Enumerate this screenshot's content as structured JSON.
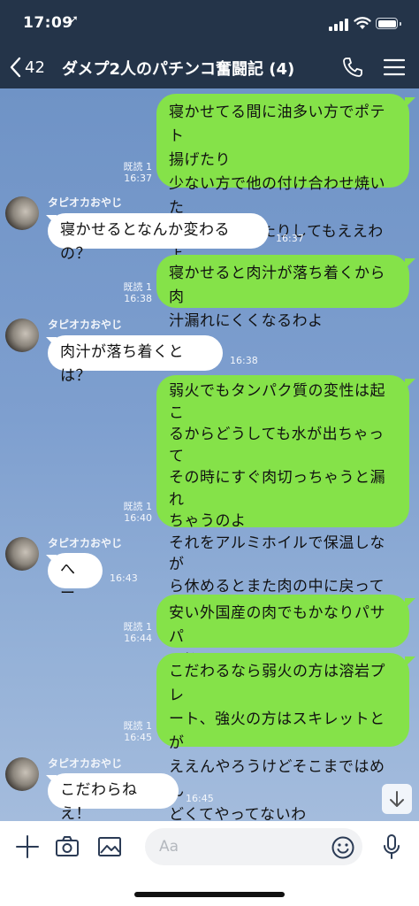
{
  "status_bar": {
    "time": "17:09",
    "location_glyph": "➚"
  },
  "header": {
    "back_count": "42",
    "title": "ダメプ2人のパチンコ奮闘記 (4)"
  },
  "messages": [
    {
      "dir": "out",
      "text": "寝かせてる間に油多い方でポテト\n揚げたり\n少ない方で他の付け合わせ焼いた\nりソース作ったりしてもええわよ",
      "read": "既読 1",
      "time": "16:37"
    },
    {
      "dir": "in",
      "sender": "タピオカおやじ",
      "text": "寝かせるとなんか変わるの？",
      "time": "16:37"
    },
    {
      "dir": "out",
      "text": "寝かせると肉汁が落ち着くから肉\n汁漏れにくくなるわよ",
      "read": "既読 1",
      "time": "16:38"
    },
    {
      "dir": "in",
      "sender": "タピオカおやじ",
      "text": "肉汁が落ち着くとは？",
      "time": "16:38"
    },
    {
      "dir": "out",
      "text": "弱火でもタンパク質の変性は起こ\nるからどうしても水が出ちゃって\nその時にすぐ肉切っちゃうと漏れ\nちゃうのよ\nそれをアルミホイルで保温しなが\nら休めるとまた肉の中に戻ってい\nくねん",
      "read": "既読 1",
      "time": "16:40"
    },
    {
      "dir": "in",
      "sender": "タピオカおやじ",
      "text": "へー",
      "time": "16:43"
    },
    {
      "dir": "out",
      "text": "安い外国産の肉でもかなりパサパ\nサ抑えられるで",
      "read": "既読 1",
      "time": "16:44"
    },
    {
      "dir": "out",
      "text": "こだわるなら弱火の方は溶岩プレ\nート、強火の方はスキレットとが\nええんやろうけどそこまではめん\nどくてやってないわ",
      "read": "既読 1",
      "time": "16:45"
    },
    {
      "dir": "in",
      "sender": "タピオカおやじ",
      "text": "こだわらねえ！",
      "time": "16:45"
    }
  ],
  "input": {
    "placeholder": "Aa"
  },
  "colors": {
    "header_bg": "#243449",
    "outgoing_bubble": "#85e249",
    "incoming_bubble": "#ffffff",
    "chat_bg": "#7e9fcf"
  },
  "icons": [
    "chevron-left-icon",
    "phone-icon",
    "menu-icon",
    "plus-icon",
    "camera-icon",
    "image-icon",
    "emoji-icon",
    "microphone-icon",
    "arrow-down-icon",
    "signal-icon",
    "wifi-icon",
    "battery-icon"
  ]
}
